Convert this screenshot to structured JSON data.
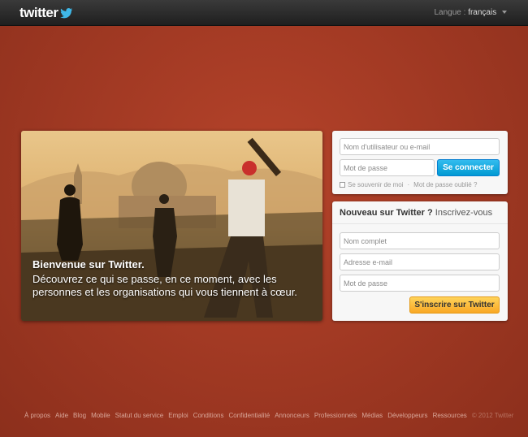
{
  "header": {
    "logo_text": "twitter",
    "language_label": "Langue :",
    "language_value": "français"
  },
  "hero": {
    "title": "Bienvenue sur Twitter.",
    "text": "Découvrez ce qui se passe, en ce moment, avec les personnes et les organisations qui vous tiennent à cœur."
  },
  "login": {
    "username_placeholder": "Nom d'utilisateur ou e-mail",
    "password_placeholder": "Mot de passe",
    "submit_label": "Se connecter",
    "remember_label": "Se souvenir de moi",
    "separator": "·",
    "forgot_label": "Mot de passe oublié ?"
  },
  "signup": {
    "heading_strong": "Nouveau sur Twitter ?",
    "heading_light": "Inscrivez-vous",
    "fullname_placeholder": "Nom complet",
    "email_placeholder": "Adresse e-mail",
    "password_placeholder": "Mot de passe",
    "submit_label": "S'inscrire sur Twitter"
  },
  "footer": {
    "links": [
      "À propos",
      "Aide",
      "Blog",
      "Mobile",
      "Statut du service",
      "Emploi",
      "Conditions",
      "Confidentialité",
      "Annonceurs",
      "Professionnels",
      "Médias",
      "Développeurs",
      "Ressources"
    ],
    "copyright": "© 2012 Twitter"
  },
  "colors": {
    "background": "#a33a24",
    "topbar": "#2b2b2b",
    "primary_button": "#019ad2",
    "signup_button": "#f9a825"
  }
}
